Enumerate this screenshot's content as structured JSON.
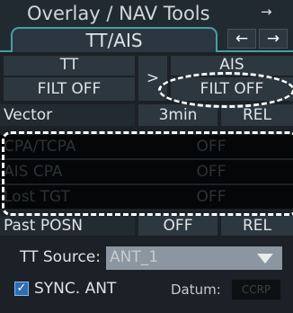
{
  "header": {
    "title": "Overlay / NAV Tools",
    "menu_arrow": "→"
  },
  "tabs": [
    {
      "label": "TT/AIS"
    }
  ],
  "nav": {
    "prev_glyph": "←",
    "next_glyph": "→"
  },
  "tt": {
    "label": "TT",
    "filter_value": "FILT OFF"
  },
  "expand": {
    "glyph": ">"
  },
  "ais": {
    "label": "AIS",
    "filter_value": "FILT OFF"
  },
  "rows": [
    {
      "label": "Vector",
      "value": "3min",
      "mode": "REL"
    },
    {
      "label": "CPA/TCPA",
      "value": "OFF"
    },
    {
      "label": "AIS CPA",
      "value": "OFF"
    },
    {
      "label": "Lost TGT",
      "value": "OFF"
    },
    {
      "label": "Past POSN",
      "value": "OFF",
      "mode": "REL"
    }
  ],
  "tt_source": {
    "label": "TT Source:",
    "value": "ANT_1"
  },
  "sync_ant": {
    "label": "SYNC. ANT",
    "checked": true,
    "check_glyph": "✓"
  },
  "datum": {
    "label": "Datum:",
    "value": "CCRP"
  },
  "colors": {
    "accent": "#4a9ea2",
    "panel": "#2d3740",
    "background": "#1b2126",
    "checkbox": "#2f6cb8"
  }
}
